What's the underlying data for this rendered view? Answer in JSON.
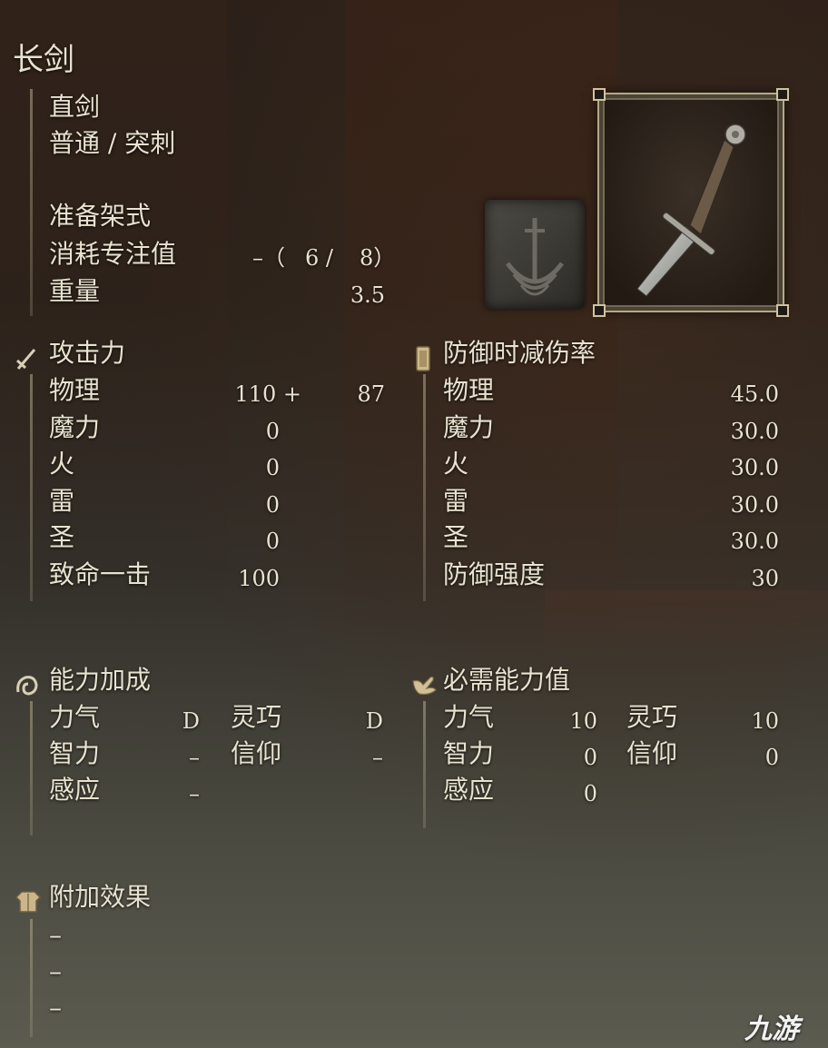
{
  "weapon": {
    "name": "长剑",
    "type": "直剑",
    "attack_type": "普通 / 突刺",
    "skill": "准备架式",
    "fp_label": "消耗专注值",
    "fp_prefix": "–（",
    "fp_value1": "6 /",
    "fp_value2": "8）",
    "weight_label": "重量",
    "weight_value": "3.5"
  },
  "attack": {
    "title": "攻击力",
    "icon": "sword-icon",
    "rows": [
      {
        "label": "物理",
        "value": "110 +",
        "bonus": "87"
      },
      {
        "label": "魔力",
        "value": "0",
        "bonus": ""
      },
      {
        "label": "火",
        "value": "0",
        "bonus": ""
      },
      {
        "label": "雷",
        "value": "0",
        "bonus": ""
      },
      {
        "label": "圣",
        "value": "0",
        "bonus": ""
      },
      {
        "label": "致命一击",
        "value": "100",
        "bonus": ""
      }
    ]
  },
  "defense": {
    "title": "防御时减伤率",
    "icon": "shield-icon",
    "rows": [
      {
        "label": "物理",
        "value": "45.0"
      },
      {
        "label": "魔力",
        "value": "30.0"
      },
      {
        "label": "火",
        "value": "30.0"
      },
      {
        "label": "雷",
        "value": "30.0"
      },
      {
        "label": "圣",
        "value": "30.0"
      },
      {
        "label": "防御强度",
        "value": "30"
      }
    ]
  },
  "scaling": {
    "title": "能力加成",
    "icon": "scaling-icon",
    "rows": [
      {
        "label1": "力气",
        "val1": "D",
        "label2": "灵巧",
        "val2": "D"
      },
      {
        "label1": "智力",
        "val1": "–",
        "label2": "信仰",
        "val2": "–"
      },
      {
        "label1": "感应",
        "val1": "–",
        "label2": "",
        "val2": ""
      }
    ]
  },
  "requirements": {
    "title": "必需能力值",
    "icon": "hand-icon",
    "rows": [
      {
        "label1": "力气",
        "val1": "10",
        "label2": "灵巧",
        "val2": "10"
      },
      {
        "label1": "智力",
        "val1": "0",
        "label2": "信仰",
        "val2": "0"
      },
      {
        "label1": "感应",
        "val1": "0",
        "label2": "",
        "val2": ""
      }
    ]
  },
  "effects": {
    "title": "附加效果",
    "icon": "armor-icon",
    "items": [
      "–",
      "–",
      "–"
    ]
  },
  "watermark": "九游",
  "colors": {
    "text": "#e8e2cf",
    "frame": "#b7a987"
  }
}
